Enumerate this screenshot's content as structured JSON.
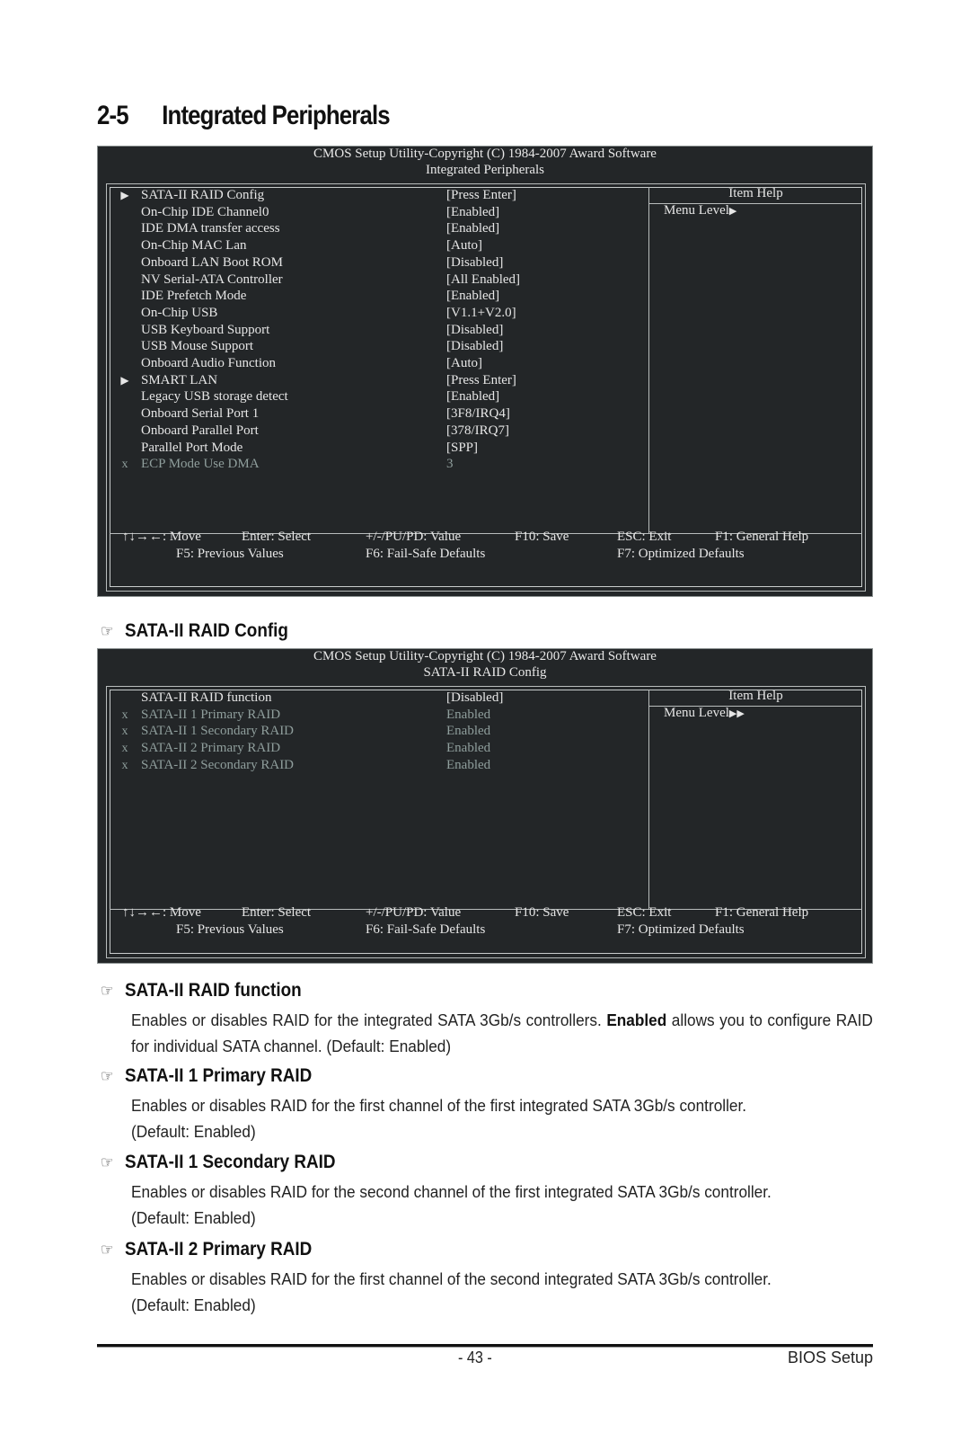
{
  "page": {
    "section_number": "2-5",
    "section_title": "Integrated Peripherals",
    "page_number": "- 43 -",
    "footer_right": "BIOS Setup"
  },
  "screen1": {
    "header_line1": "CMOS Setup Utility-Copyright (C) 1984-2007 Award Software",
    "header_line2": "Integrated Peripherals",
    "items": [
      {
        "marker": "submenu-arrow",
        "label": "SATA-II RAID Config",
        "value": "[Press Enter]",
        "disabled": false
      },
      {
        "marker": "",
        "label": "On-Chip IDE Channel0",
        "value": "[Enabled]",
        "disabled": false
      },
      {
        "marker": "",
        "label": "IDE DMA transfer access",
        "value": "[Enabled]",
        "disabled": false
      },
      {
        "marker": "",
        "label": "On-Chip MAC Lan",
        "value": "[Auto]",
        "disabled": false
      },
      {
        "marker": "",
        "label": "Onboard LAN Boot ROM",
        "value": "[Disabled]",
        "disabled": false
      },
      {
        "marker": "",
        "label": "NV Serial-ATA Controller",
        "value": "[All Enabled]",
        "disabled": false
      },
      {
        "marker": "",
        "label": "IDE Prefetch Mode",
        "value": "[Enabled]",
        "disabled": false
      },
      {
        "marker": "",
        "label": "On-Chip USB",
        "value": "[V1.1+V2.0]",
        "disabled": false
      },
      {
        "marker": "",
        "label": "USB Keyboard Support",
        "value": "[Disabled]",
        "disabled": false
      },
      {
        "marker": "",
        "label": "USB Mouse Support",
        "value": "[Disabled]",
        "disabled": false
      },
      {
        "marker": "",
        "label": "Onboard Audio Function",
        "value": "[Auto]",
        "disabled": false
      },
      {
        "marker": "submenu-arrow",
        "label": "SMART LAN",
        "value": "[Press Enter]",
        "disabled": false
      },
      {
        "marker": "",
        "label": "Legacy USB storage detect",
        "value": "[Enabled]",
        "disabled": false
      },
      {
        "marker": "",
        "label": "Onboard Serial Port 1",
        "value": "[3F8/IRQ4]",
        "disabled": false
      },
      {
        "marker": "",
        "label": "Onboard Parallel Port",
        "value": "[378/IRQ7]",
        "disabled": false
      },
      {
        "marker": "",
        "label": "Parallel Port Mode",
        "value": "[SPP]",
        "disabled": false
      },
      {
        "marker": "x",
        "label": "ECP Mode Use DMA",
        "value": "3",
        "disabled": true
      }
    ],
    "help_title": "Item Help",
    "help_text": "Menu Level",
    "help_arrows": "▶"
  },
  "screen2": {
    "header_line1": "CMOS Setup Utility-Copyright (C) 1984-2007 Award Software",
    "header_line2": "SATA-II RAID Config",
    "items": [
      {
        "marker": "",
        "label": "SATA-II RAID function",
        "value": "[Disabled]",
        "disabled": false
      },
      {
        "marker": "x",
        "label": "SATA-II 1 Primary RAID",
        "value": "Enabled",
        "disabled": true
      },
      {
        "marker": "x",
        "label": "SATA-II 1 Secondary RAID",
        "value": "Enabled",
        "disabled": true
      },
      {
        "marker": "x",
        "label": "SATA-II 2 Primary RAID",
        "value": "Enabled",
        "disabled": true
      },
      {
        "marker": "x",
        "label": "SATA-II 2 Secondary RAID",
        "value": "Enabled",
        "disabled": true
      }
    ],
    "help_title": "Item Help",
    "help_text": "Menu Level",
    "help_arrows": "▶▶"
  },
  "keys": {
    "move": "↑↓→←: Move",
    "select": "Enter: Select",
    "value": "+/-/PU/PD: Value",
    "save": "F10: Save",
    "exit": "ESC: Exit",
    "general_help": "F1: General Help",
    "previous": "F5: Previous Values",
    "failsafe": "F6: Fail-Safe Defaults",
    "optimized": "F7: Optimized Defaults"
  },
  "sections": [
    {
      "heading": "SATA-II RAID Config"
    },
    {
      "heading": "SATA-II RAID function",
      "body_before_bold": "Enables or disables RAID for the integrated SATA 3Gb/s controllers. ",
      "body_bold": "Enabled",
      "body_after_bold": " allows you to configure RAID for individual SATA channel. (Default: Enabled)"
    },
    {
      "heading": "SATA-II 1 Primary RAID",
      "body_line1": "Enables or disables RAID for the first channel of the first integrated SATA 3Gb/s controller.",
      "body_line2": "(Default: Enabled)"
    },
    {
      "heading": "SATA-II 1 Secondary RAID",
      "body_line1": "Enables or disables RAID for the second channel of the first integrated SATA 3Gb/s controller.",
      "body_line2": "(Default: Enabled)"
    },
    {
      "heading": "SATA-II 2 Primary RAID",
      "body_line1": "Enables or disables RAID for the first channel of the second integrated SATA 3Gb/s controller.",
      "body_line2": "(Default: Enabled)"
    }
  ],
  "icons": {
    "pointing_hand": "☞"
  }
}
